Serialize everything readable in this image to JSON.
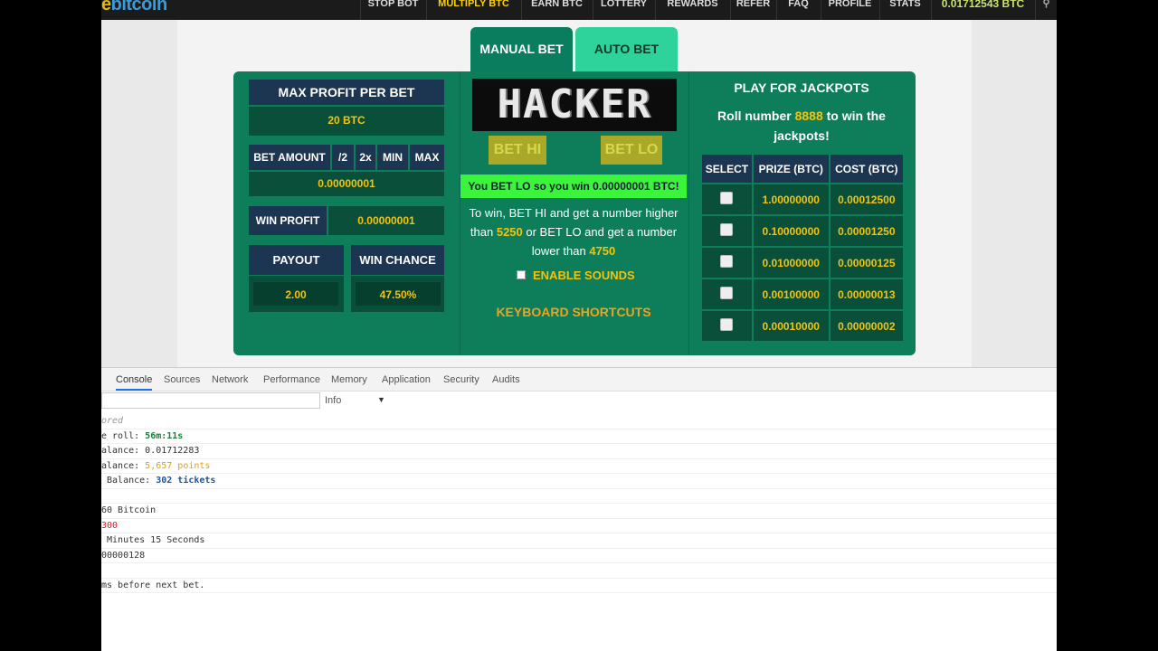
{
  "nav": {
    "logo_prefix": "e",
    "logo_rest": "bitcoin",
    "items": [
      "STOP BOT",
      "MULTIPLY BTC",
      "EARN BTC",
      "LOTTERY",
      "REWARDS",
      "REFER",
      "FAQ",
      "PROFILE",
      "STATS"
    ],
    "balance": "0.01712543 BTC"
  },
  "tabs": {
    "manual": "MANUAL BET",
    "auto": "AUTO BET"
  },
  "left": {
    "max_profit_label": "MAX PROFIT PER BET",
    "max_profit_value": "20 BTC",
    "bet_amount_label": "BET AMOUNT",
    "bet_amount_half": "/2",
    "bet_amount_double": "2x",
    "bet_amount_min": "MIN",
    "bet_amount_max": "MAX",
    "bet_amount_value": "0.00000001",
    "win_profit_label": "WIN PROFIT",
    "win_profit_value": "0.00000001",
    "payout_label": "PAYOUT",
    "payout_value": "2.00",
    "win_chance_label": "WIN CHANCE",
    "win_chance_value": "47.50%"
  },
  "center": {
    "logo_text": "HACKER",
    "bet_hi": "BET HI",
    "bet_lo": "BET LO",
    "win_message": "You BET LO so you win 0.00000001 BTC!",
    "rules_1": "To win, BET HI and get a number higher than",
    "hi_number": "5250",
    "rules_2": "or BET LO and get a number lower than",
    "lo_number": "4750",
    "sounds_label": "ENABLE SOUNDS",
    "shortcuts": "KEYBOARD SHORTCUTS"
  },
  "jackpot": {
    "title": "PLAY FOR JACKPOTS",
    "sub_1": "Roll number",
    "number": "8888",
    "sub_2": "to win the jackpots!",
    "headers": [
      "SELECT",
      "PRIZE (BTC)",
      "COST (BTC)"
    ],
    "rows": [
      {
        "prize": "1.00000000",
        "cost": "0.00012500"
      },
      {
        "prize": "0.10000000",
        "cost": "0.00001250"
      },
      {
        "prize": "0.01000000",
        "cost": "0.00000125"
      },
      {
        "prize": "0.00100000",
        "cost": "0.00000013"
      },
      {
        "prize": "0.00010000",
        "cost": "0.00000002"
      }
    ]
  },
  "devtools": {
    "tabs": [
      "Console",
      "Sources",
      "Network",
      "Performance",
      "Memory",
      "Application",
      "Security",
      "Audits"
    ],
    "level": "Info",
    "lines": {
      "l0": "ored",
      "l1_a": "e roll: ",
      "l1_b": "56m:11s",
      "l2": "alance: 0.01712283",
      "l3_a": "alance: ",
      "l3_b": "5,657 points",
      "l4_a": " Balance: ",
      "l4_b": "302 tickets",
      "l5": "",
      "l6": "60 Bitcoin",
      "l7": "300",
      "l8": " Minutes 15 Seconds",
      "l9": "00000128",
      "l10": "",
      "l11": "ms before next bet."
    }
  }
}
